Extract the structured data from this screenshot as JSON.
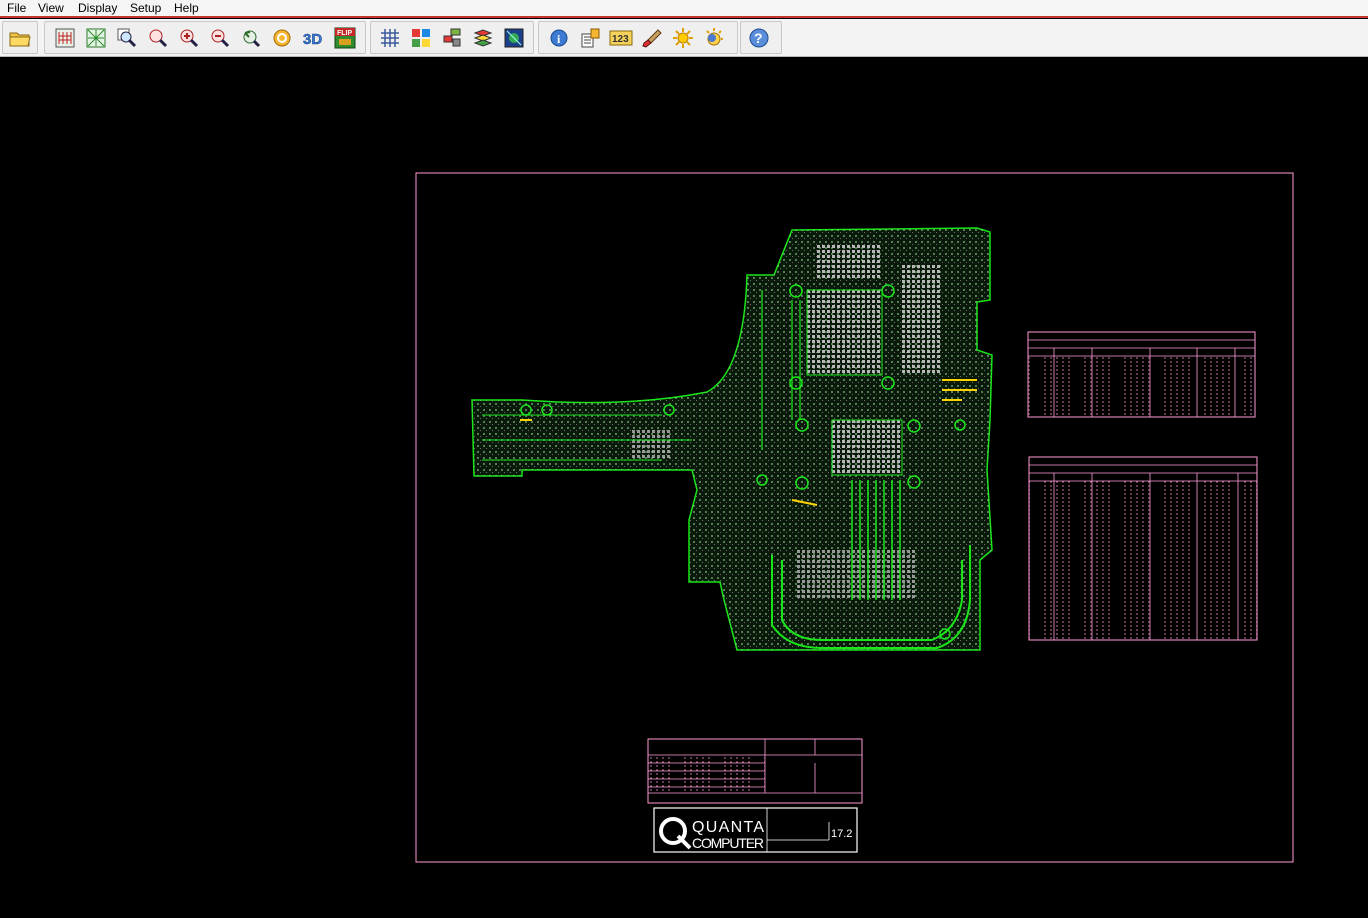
{
  "menu": {
    "items": [
      {
        "label": "File",
        "name": "menu-file"
      },
      {
        "label": "View",
        "name": "menu-view"
      },
      {
        "label": "Display",
        "name": "menu-display"
      },
      {
        "label": "Setup",
        "name": "menu-setup"
      },
      {
        "label": "Help",
        "name": "menu-help"
      }
    ]
  },
  "toolbar": {
    "flip_label": "FLIP",
    "three_d_label": "3D",
    "nums_label": "123",
    "help_label": "?",
    "info_label": "i"
  },
  "drawing": {
    "logo_line1": "QUANTA",
    "logo_line2": "COMPUTER",
    "revision": "17.2"
  },
  "colors": {
    "frame": "#ff9ad6",
    "trace": "#19e619",
    "component": "#b8b8b8",
    "accent": "#c0392b"
  }
}
